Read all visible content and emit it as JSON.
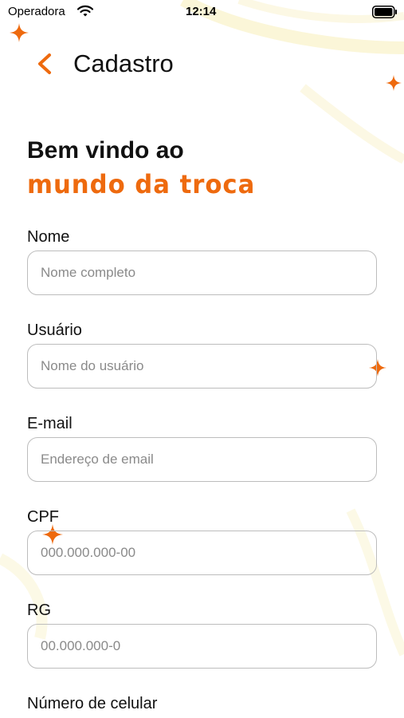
{
  "status_bar": {
    "carrier": "Operadora",
    "time": "12:14"
  },
  "header": {
    "title": "Cadastro"
  },
  "welcome": {
    "line1": "Bem vindo ao",
    "brand": "mundo da troca"
  },
  "colors": {
    "accent": "#ee6a0e",
    "border": "#bdbdbd",
    "placeholder": "#8a8a8a"
  },
  "form": {
    "fields": [
      {
        "label": "Nome",
        "placeholder": "Nome completo",
        "value": ""
      },
      {
        "label": "Usuário",
        "placeholder": "Nome do usuário",
        "value": ""
      },
      {
        "label": "E-mail",
        "placeholder": "Endereço de email",
        "value": ""
      },
      {
        "label": "CPF",
        "placeholder": "000.000.000-00",
        "value": ""
      },
      {
        "label": "RG",
        "placeholder": "00.000.000-0",
        "value": ""
      },
      {
        "label": "Número de celular",
        "placeholder": "",
        "value": ""
      }
    ]
  }
}
